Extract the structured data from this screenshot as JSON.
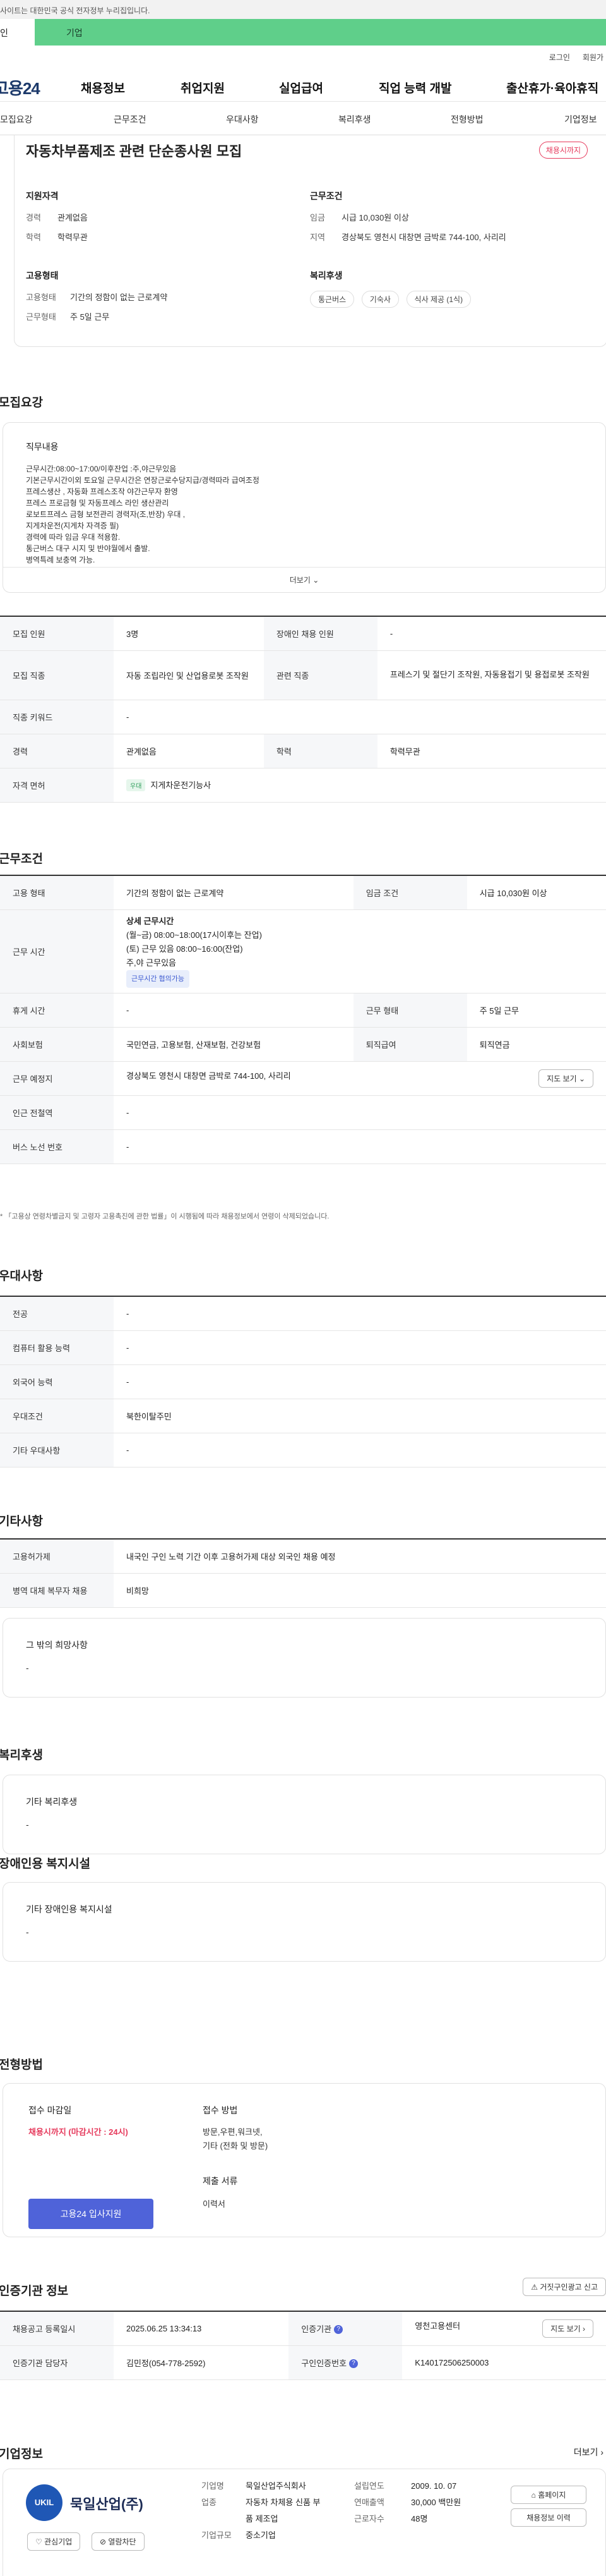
{
  "top": {
    "gov_notice": "사이트는 대한민국 공식 전자정부 누리집입니다.",
    "tab_person": "인",
    "tab_biz": "기업",
    "login": "로그인",
    "join": "회원가"
  },
  "gnb": {
    "logo": "고용24",
    "items": [
      "채용정보",
      "취업지원",
      "실업급여",
      "직업 능력 개발",
      "출산휴가·육아휴직"
    ]
  },
  "subnav": [
    "모집요강",
    "근무조건",
    "우대사항",
    "복리후생",
    "전형방법",
    "기업정보"
  ],
  "summary": {
    "title": "자동차부품제조 관련 단순종사원 모집",
    "status": "채용시까지",
    "qual_title": "지원자격",
    "career_k": "경력",
    "career_v": "관계없음",
    "edu_k": "학력",
    "edu_v": "학력무관",
    "cond_title": "근무조건",
    "wage_k": "임금",
    "wage_v": "시급 10,030원 이상",
    "region_k": "지역",
    "region_v": "경상북도 영천시 대창면 금박로 744-100, 사리리",
    "emp_title": "고용형태",
    "emptype_k": "고용형태",
    "emptype_v": "기간의 정함이 없는 근로계약",
    "worktype_k": "근무형태",
    "worktype_v": "주 5일 근무",
    "welfare_title": "복리후생",
    "welfare": [
      "통근버스",
      "기숙사",
      "식사 제공 (1식)"
    ]
  },
  "recruit": {
    "section": "모집요강",
    "duty_title": "직무내용",
    "duty_lines": [
      "근무시간:08:00~17:00/이후잔업 :주,야근무있음",
      "기본근무시간이외 토요일 근무시간은 연장근로수당지급/경력따라 급여조정",
      "프레스생산 , 자동화 프레스조작 야간근무자 환영",
      "프레스 프로금형 및 자동프레스 라인 생산관리",
      "로보트프레스 금형 보전관리  경력자(조,반장) 우대 ,",
      "지게차운전(지게차 자격증 필)",
      "경력에 따라 임금 우대 적용함.",
      "통근버스 대구 시지 및 반야월에서 출발.",
      "병역특례 보충역 가능."
    ],
    "more": "더보기",
    "rows": [
      [
        "모집 인원",
        "3명",
        "장애인 채용 인원",
        "-"
      ],
      [
        "모집 직종",
        "자동 조립라인 및 산업용로봇 조작원",
        "관련 직종",
        "프레스기 및 절단기 조작원, 자동용접기 및 용접로봇 조작원"
      ],
      [
        "직종 키워드",
        "-"
      ],
      [
        "경력",
        "관계없음",
        "학력",
        "학력무관"
      ],
      [
        "자격 면허",
        "지게차운전기능사"
      ]
    ],
    "license_chip": "우대"
  },
  "work": {
    "section": "근무조건",
    "emp_k": "고용 형태",
    "emp_v": "기간의 정함이 없는 근로계약",
    "wage_k": "임금 조건",
    "wage_v": "시급 10,030원 이상",
    "hours_k": "근무 시간",
    "hours_title": "상세 근무시간",
    "hours_lines": [
      "(월~금) 08:00~18:00(17시이후는 잔업)",
      "(토) 근무 있음 08:00~16:00(잔업)",
      "주,야 근무있음"
    ],
    "hours_chip": "근무시간 협의가능",
    "rest_k": "휴게 시간",
    "rest_v": "-",
    "form_k": "근무 형태",
    "form_v": "주 5일 근무",
    "ins_k": "사회보험",
    "ins_v": "국민연금, 고용보험, 산재보험, 건강보험",
    "sev_k": "퇴직급여",
    "sev_v": "퇴직연금",
    "place_k": "근무 예정지",
    "place_v": "경상북도 영천시 대창면 금박로 744-100, 사리리",
    "map_btn": "지도 보기",
    "station_k": "인근 전철역",
    "station_v": "-",
    "bus_k": "버스 노선 번호",
    "bus_v": "-",
    "note": "「고용상 연령차별금지 및 고령자 고용촉진에 관한 법률」이 시행됨에 따라 채용정보에서 연령이 삭제되었습니다."
  },
  "pref": {
    "section": "우대사항",
    "rows": [
      [
        "전공",
        "-"
      ],
      [
        "컴퓨터 활용 능력",
        "-"
      ],
      [
        "외국어 능력",
        "-"
      ],
      [
        "우대조건",
        "북한이탈주민"
      ],
      [
        "기타 우대사항",
        "-"
      ]
    ]
  },
  "etc": {
    "section": "기타사항",
    "rows": [
      [
        "고용허가제",
        "내국인 구인 노력 기간 이후 고용허가제 대상 외국인 채용 예정"
      ],
      [
        "병역 대체 복무자 채용",
        "비희망"
      ]
    ],
    "hope_title": "그 밖의 희망사항",
    "hope_v": "-"
  },
  "welfare": {
    "section": "복리후생",
    "title": "기타 복리후생",
    "v": "-"
  },
  "disabled": {
    "section": "장애인용 복지시설",
    "title": "기타 장애인용 복지시설",
    "v": "-"
  },
  "apply": {
    "section": "전형방법",
    "deadline_title": "접수 마감일",
    "deadline_v": "채용시까지 (마감시간 : 24시)",
    "method_title": "접수 방법",
    "method_lines": [
      "방문,우편,워크넷,",
      "기타 (전화 및 방문)"
    ],
    "docs_title": "제출 서류",
    "docs_v": "이력서",
    "apply_btn": "고용24 입사지원"
  },
  "cert": {
    "section": "인증기관 정보",
    "report_btn": "거짓구인광고 신고",
    "reg_k": "채용공고 등록일시",
    "reg_v": "2025.06.25 13:34:13",
    "org_k": "인증기관",
    "org_v": "영천고용센터",
    "map_btn": "지도 보기",
    "mgr_k": "인증기관 담당자",
    "mgr_v": "김민정(054-778-2592)",
    "no_k": "구인인증번호",
    "no_v": "K140172506250003"
  },
  "company": {
    "section": "기업정보",
    "more": "더보기",
    "logo_text": "UKIL",
    "name": "묵일산업(주)",
    "interest_btn": "관심기업",
    "block_btn": "열람차단",
    "name_k": "기업명",
    "name_v": "묵일산업주식회사",
    "ind_k": "업종",
    "ind_v": "자동차 차체용 신품 부품 제조업",
    "size_k": "기업규모",
    "size_v": "중소기업",
    "found_k": "설립연도",
    "found_v": "2009. 10. 07",
    "sales_k": "연매출액",
    "sales_v": "30,000 백만원",
    "emp_k": "근로자수",
    "emp_v": "48명",
    "home_btn": "홈페이지",
    "hist_btn": "채용정보 이력"
  }
}
